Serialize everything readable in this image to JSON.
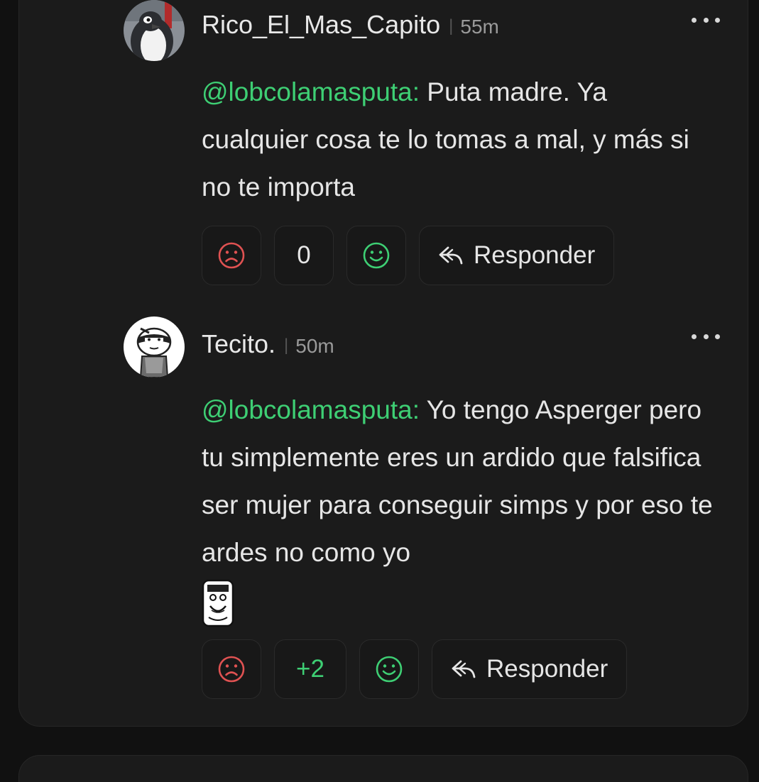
{
  "comments": [
    {
      "username": "Rico_El_Mas_Capito",
      "separator": "|",
      "time": "55m",
      "mention": "@lobcolamasputa:",
      "text": " Puta madre. Ya cualquier cosa te lo tomas a mal, y más si no te importa",
      "score": "0",
      "reply_label": "Responder",
      "avatar_icon": "penguin-avatar-icon"
    },
    {
      "username": "Tecito.",
      "separator": "|",
      "time": "50m",
      "mention": "@lobcolamasputa:",
      "text": " Yo tengo Asperger pero tu simplemente eres un ardido que falsifica ser mujer para conseguir simps y por eso te ardes no como yo",
      "score": "+2",
      "reply_label": "Responder",
      "avatar_icon": "ninja-avatar-icon",
      "sticker_icon": "trollface-sticker-icon"
    }
  ],
  "colors": {
    "mention": "#3ecf74",
    "dislike": "#e05252",
    "like": "#3ecf74",
    "background": "#111111",
    "card": "#1b1b1b"
  }
}
